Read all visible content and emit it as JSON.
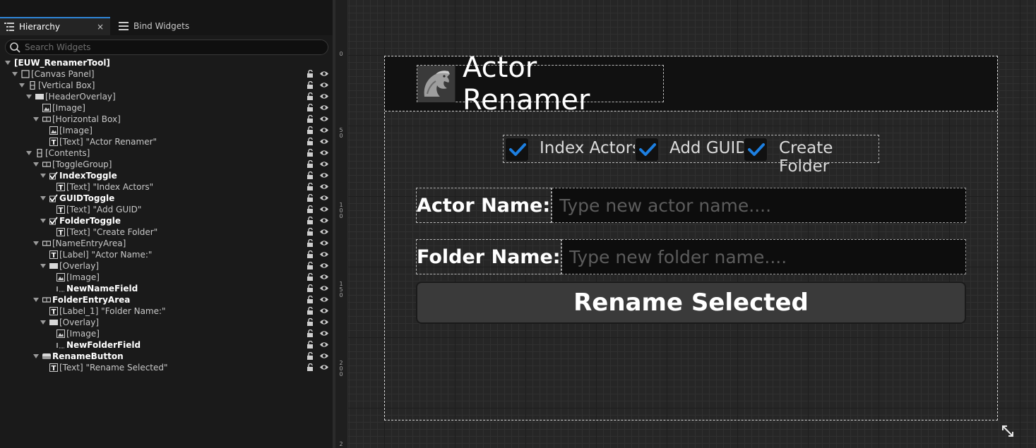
{
  "tabs": {
    "hierarchy": "Hierarchy",
    "bind_widgets": "Bind Widgets",
    "close": "×"
  },
  "search": {
    "placeholder": "Search Widgets"
  },
  "tree": [
    {
      "label": "[EUW_RenamerTool]",
      "bold": true
    },
    {
      "label": "[Canvas Panel]",
      "icon": "canvas-panel-icon"
    },
    {
      "label": "[Vertical Box]",
      "icon": "vertical-box-icon"
    },
    {
      "label": "[HeaderOverlay]",
      "icon": "overlay-icon"
    },
    {
      "label": "[Image]",
      "icon": "image-icon"
    },
    {
      "label": "[Horizontal Box]",
      "icon": "horizontal-box-icon"
    },
    {
      "label": "[Image]",
      "icon": "image-icon"
    },
    {
      "label": "[Text] \"Actor Renamer\"",
      "icon": "text-icon"
    },
    {
      "label": "[Contents]",
      "icon": "vertical-box-icon"
    },
    {
      "label": "[ToggleGroup]",
      "icon": "horizontal-box-icon"
    },
    {
      "label": "IndexToggle",
      "icon": "checkbox-icon",
      "bold": true
    },
    {
      "label": "[Text] \"Index Actors\"",
      "icon": "text-icon"
    },
    {
      "label": "GUIDToggle",
      "icon": "checkbox-icon",
      "bold": true
    },
    {
      "label": "[Text] \"Add GUID\"",
      "icon": "text-icon"
    },
    {
      "label": "FolderToggle",
      "icon": "checkbox-icon",
      "bold": true
    },
    {
      "label": "[Text] \"Create Folder\"",
      "icon": "text-icon"
    },
    {
      "label": "[NameEntryArea]",
      "icon": "horizontal-box-icon"
    },
    {
      "label": "[Label] \"Actor Name:\"",
      "icon": "text-icon"
    },
    {
      "label": "[Overlay]",
      "icon": "overlay-icon"
    },
    {
      "label": "[Image]",
      "icon": "image-icon"
    },
    {
      "label": "NewNameField",
      "icon": "text-field-icon",
      "bold": true
    },
    {
      "label": "FolderEntryArea",
      "icon": "horizontal-box-icon",
      "bold": true
    },
    {
      "label": "[Label_1] \"Folder Name:\"",
      "icon": "text-icon"
    },
    {
      "label": "[Overlay]",
      "icon": "overlay-icon"
    },
    {
      "label": "[Image]",
      "icon": "image-icon"
    },
    {
      "label": "NewFolderField",
      "icon": "text-field-icon",
      "bold": true
    },
    {
      "label": "RenameButton",
      "icon": "button-icon",
      "bold": true
    },
    {
      "label": "[Text] \"Rename Selected\"",
      "icon": "text-icon"
    }
  ],
  "ruler": {
    "labels": [
      "0",
      "5\n0",
      "1\n0\n0",
      "1\n5\n0",
      "2\n0\n0",
      "2"
    ]
  },
  "widget": {
    "title": "Actor Renamer",
    "toggles": [
      {
        "label": "Index Actors",
        "checked": true
      },
      {
        "label": "Add GUID",
        "checked": true
      },
      {
        "label": "Create Folder",
        "checked": true
      }
    ],
    "actor_name": {
      "label": "Actor Name:",
      "placeholder": "Type new actor name....",
      "value": ""
    },
    "folder_name": {
      "label": "Folder Name:",
      "placeholder": "Type new folder name....",
      "value": ""
    },
    "rename_button": "Rename Selected"
  },
  "colors": {
    "accent": "#2f86d8",
    "check": "#1d7fe0",
    "panel_bg": "#1a1a1a",
    "canvas_bg": "#262626"
  }
}
